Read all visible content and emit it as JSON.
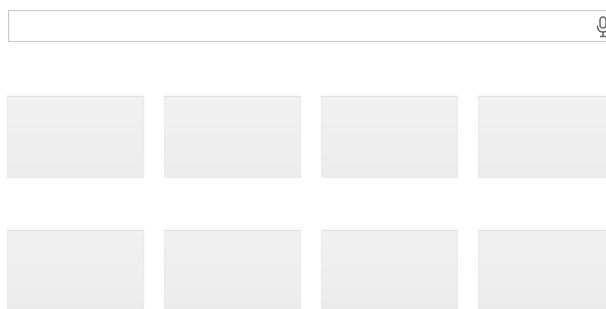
{
  "search": {
    "value": "",
    "placeholder": ""
  },
  "icons": {
    "microphone": "microphone-icon"
  },
  "colors": {
    "tile": "#eeeeee",
    "search_border": "#c9c9c9",
    "icon": "#666666"
  },
  "tiles": [
    {
      "id": 1
    },
    {
      "id": 2
    },
    {
      "id": 3
    },
    {
      "id": 4
    },
    {
      "id": 5
    },
    {
      "id": 6
    },
    {
      "id": 7
    },
    {
      "id": 8
    }
  ]
}
